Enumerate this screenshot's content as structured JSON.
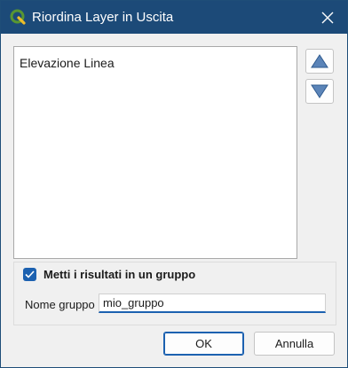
{
  "window": {
    "title": "Riordina Layer in Uscita",
    "icon": "qgis-logo-icon",
    "close_icon": "close-icon"
  },
  "layer_list": {
    "items": [
      {
        "label": "Elevazione Linea"
      }
    ],
    "move_up_icon": "triangle-up-icon",
    "move_down_icon": "triangle-down-icon"
  },
  "group": {
    "checkbox_label": "Metti i risultati in un gruppo",
    "checked": true,
    "name_label": "Nome gruppo",
    "name_value": "mio_gruppo"
  },
  "buttons": {
    "ok_label": "OK",
    "cancel_label": "Annulla"
  },
  "colors": {
    "titlebar": "#1c4a78",
    "accent": "#1c61b0",
    "qgis_green": "#589632",
    "qgis_yellow": "#eebd2a",
    "arrow_blue": "#5b84b8"
  }
}
